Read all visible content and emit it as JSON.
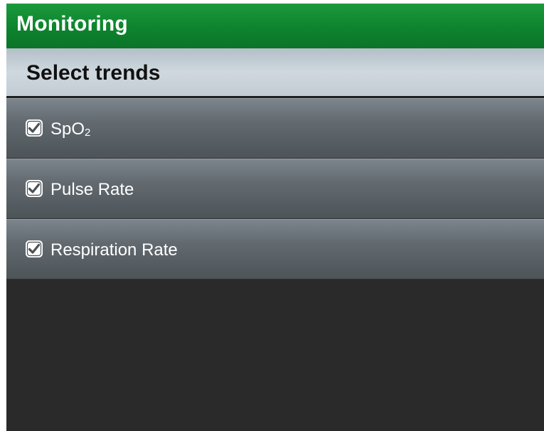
{
  "header": {
    "title": "Monitoring"
  },
  "section": {
    "title": "Select trends"
  },
  "trends": [
    {
      "label": "SpO",
      "sub": "2",
      "checked": true,
      "icon": "checkbox-checked-icon"
    },
    {
      "label": "Pulse Rate",
      "sub": "",
      "checked": true,
      "icon": "checkbox-checked-icon"
    },
    {
      "label": "Respiration Rate",
      "sub": "",
      "checked": true,
      "icon": "checkbox-checked-icon"
    }
  ],
  "colors": {
    "title_bar": "#0f8730",
    "section_header": "#cfd8de",
    "row": "#626a70",
    "background": "#2a2a2a"
  }
}
